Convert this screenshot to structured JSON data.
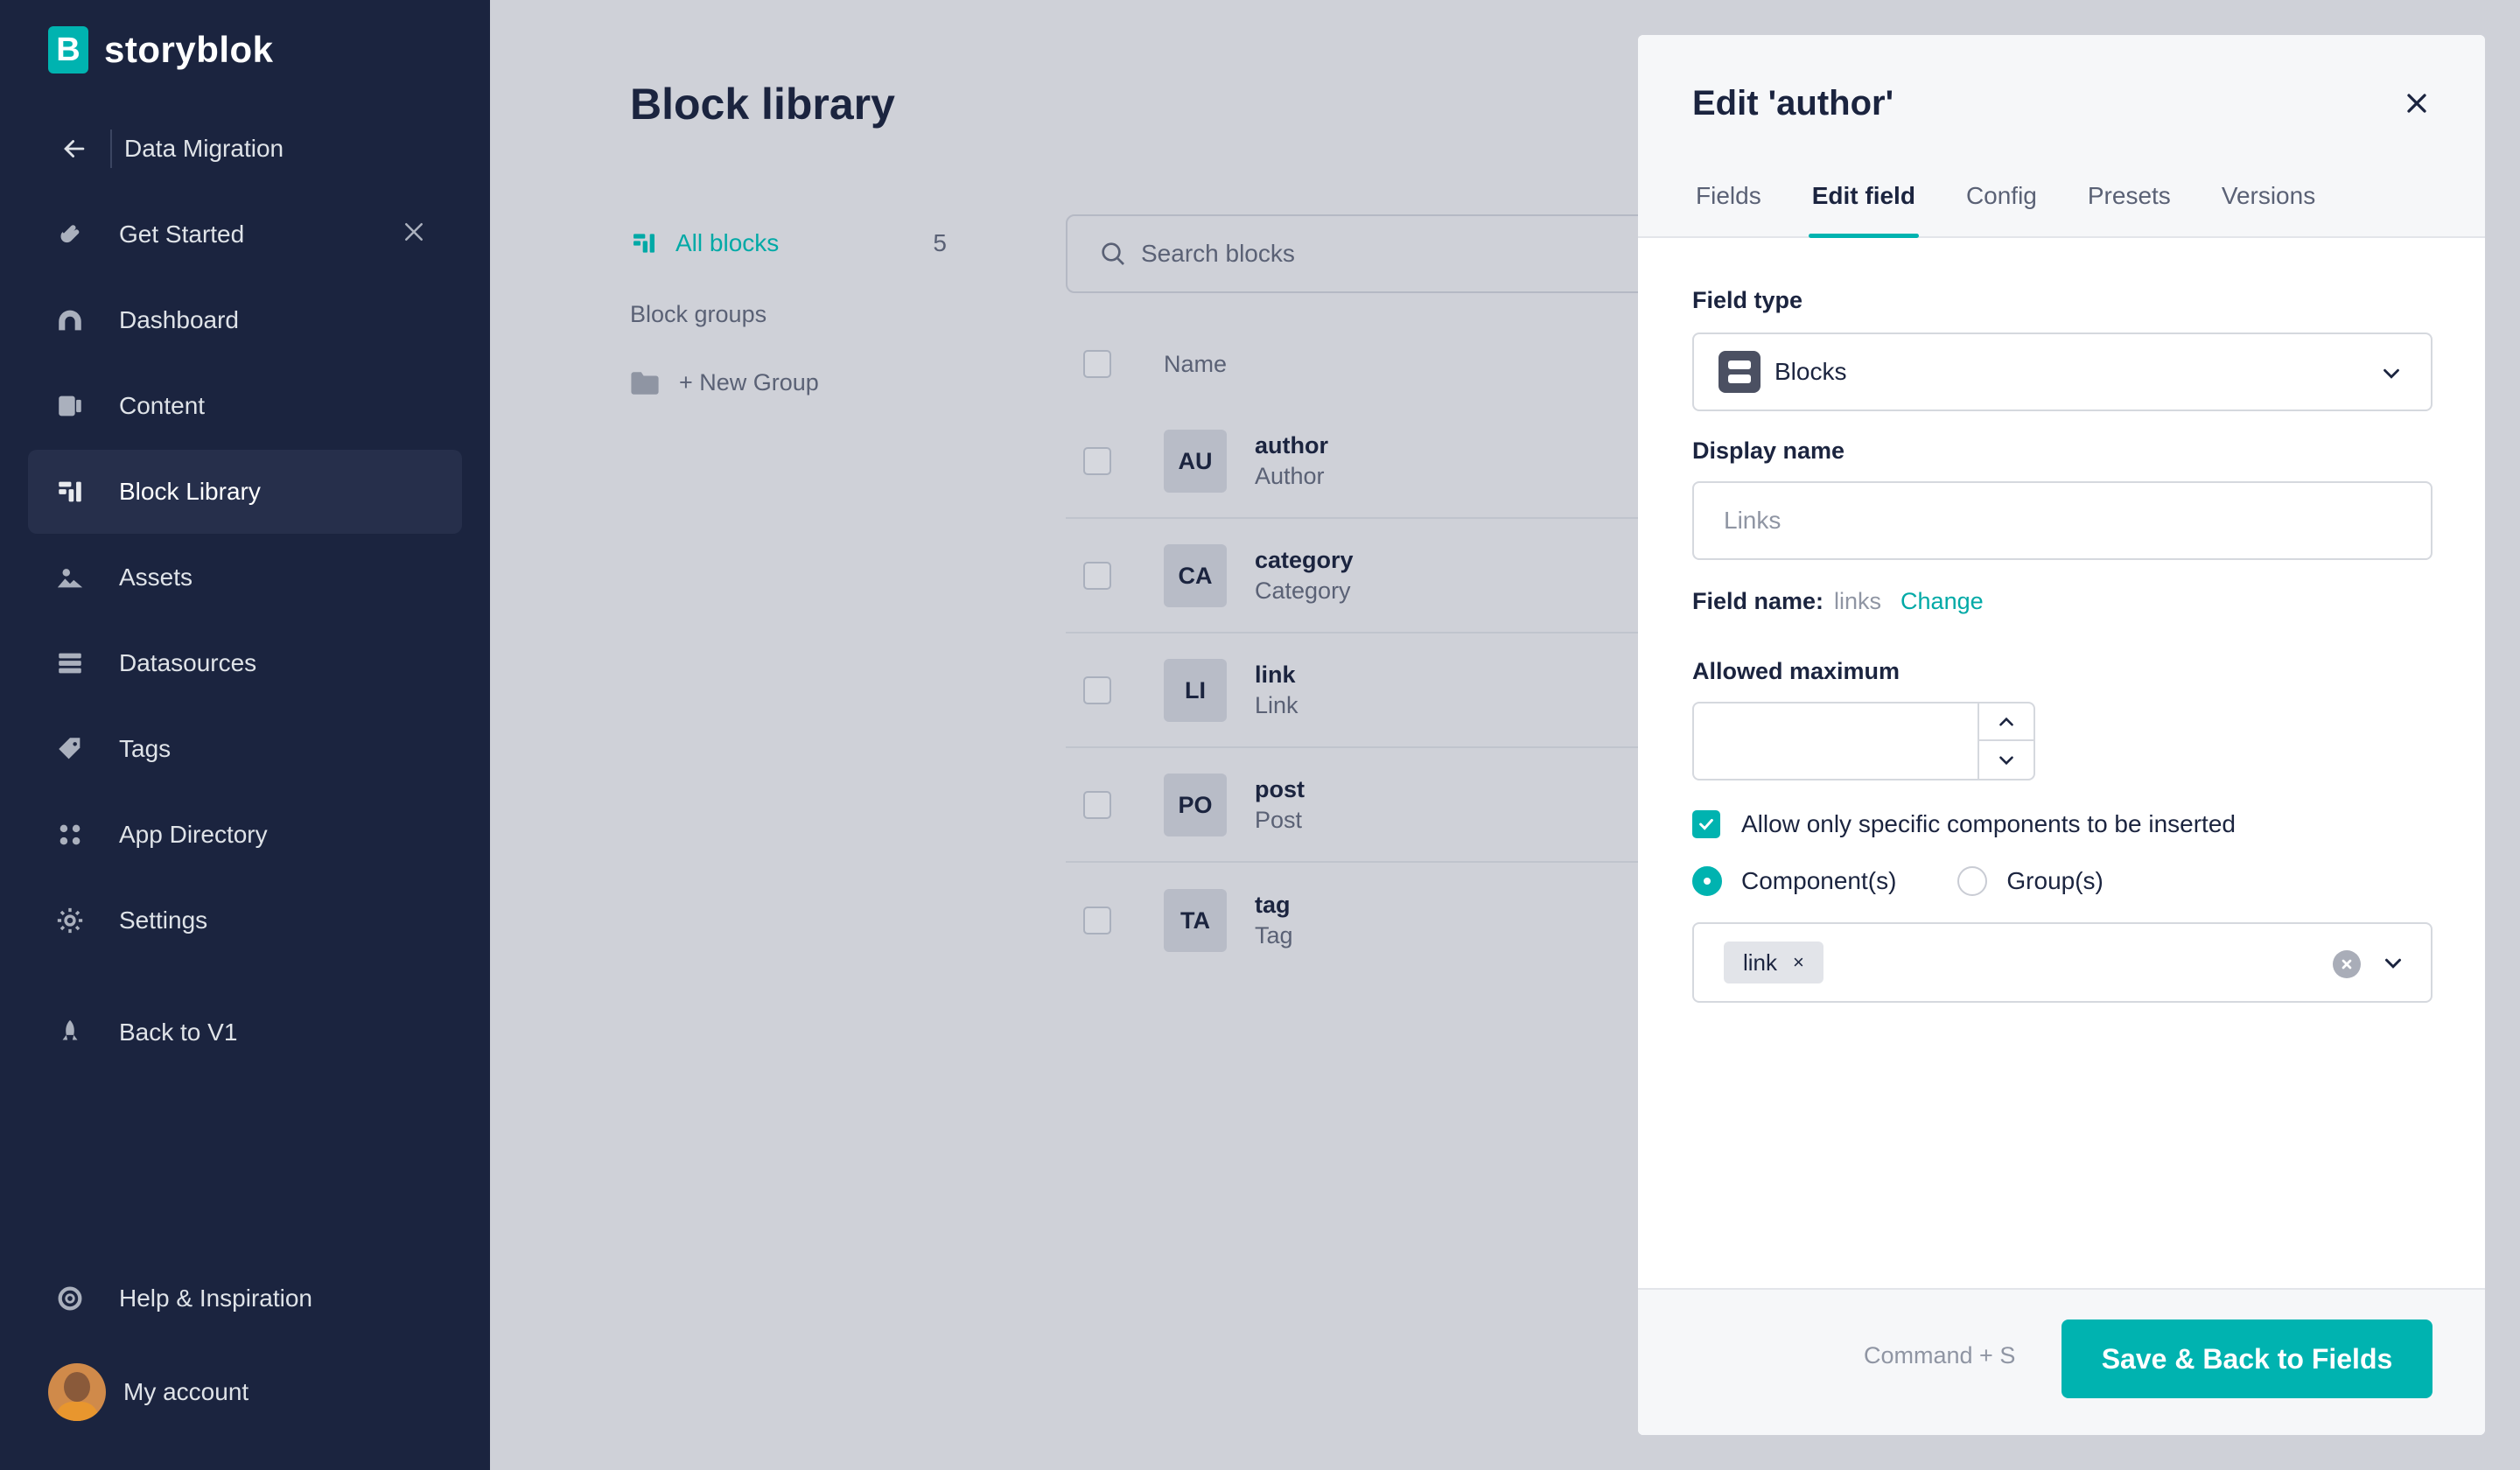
{
  "brand": {
    "name": "storyblok",
    "logo_letter": "B",
    "accent": "#00b3b0",
    "sidebar_bg": "#1b243f"
  },
  "sidebar": {
    "back_label": "Data Migration",
    "items": [
      {
        "label": "Get Started",
        "icon": "hand-wave-icon"
      },
      {
        "label": "Dashboard",
        "icon": "dashboard-icon"
      },
      {
        "label": "Content",
        "icon": "content-icon"
      },
      {
        "label": "Block Library",
        "icon": "block-library-icon",
        "active": true
      },
      {
        "label": "Assets",
        "icon": "assets-icon"
      },
      {
        "label": "Datasources",
        "icon": "datasources-icon"
      },
      {
        "label": "Tags",
        "icon": "tag-icon"
      },
      {
        "label": "App Directory",
        "icon": "apps-grid-icon"
      },
      {
        "label": "Settings",
        "icon": "gear-icon"
      },
      {
        "label": "Back to V1",
        "icon": "rocket-icon"
      },
      {
        "label": "Help & Inspiration",
        "icon": "lifebuoy-icon"
      }
    ],
    "account_label": "My account"
  },
  "main": {
    "title": "Block library",
    "all_blocks": {
      "label": "All blocks",
      "count": "5"
    },
    "block_groups_label": "Block groups",
    "new_group_label": "+ New Group",
    "search": {
      "placeholder": "Search blocks",
      "value": ""
    },
    "table": {
      "header": "Name",
      "rows": [
        {
          "badge": "AU",
          "name": "author",
          "display": "Author"
        },
        {
          "badge": "CA",
          "name": "category",
          "display": "Category"
        },
        {
          "badge": "LI",
          "name": "link",
          "display": "Link"
        },
        {
          "badge": "PO",
          "name": "post",
          "display": "Post"
        },
        {
          "badge": "TA",
          "name": "tag",
          "display": "Tag"
        }
      ]
    }
  },
  "panel": {
    "title": "Edit 'author'",
    "tabs": [
      "Fields",
      "Edit field",
      "Config",
      "Presets",
      "Versions"
    ],
    "active_tab": "Edit field",
    "field_type": {
      "label": "Field type",
      "value": "Blocks"
    },
    "display_name": {
      "label": "Display name",
      "placeholder": "Links",
      "value": ""
    },
    "field_name": {
      "label": "Field name:",
      "value": "links",
      "change_label": "Change"
    },
    "allowed_maximum": {
      "label": "Allowed maximum",
      "value": ""
    },
    "restrict_checkbox": {
      "label": "Allow only specific components to be inserted",
      "checked": true
    },
    "radios": [
      {
        "label": "Component(s)",
        "selected": true
      },
      {
        "label": "Group(s)",
        "selected": false
      }
    ],
    "selected_components": [
      {
        "label": "link",
        "remove": "×"
      }
    ],
    "footer": {
      "shortcut": "Command + S",
      "save_label": "Save & Back to Fields"
    }
  }
}
